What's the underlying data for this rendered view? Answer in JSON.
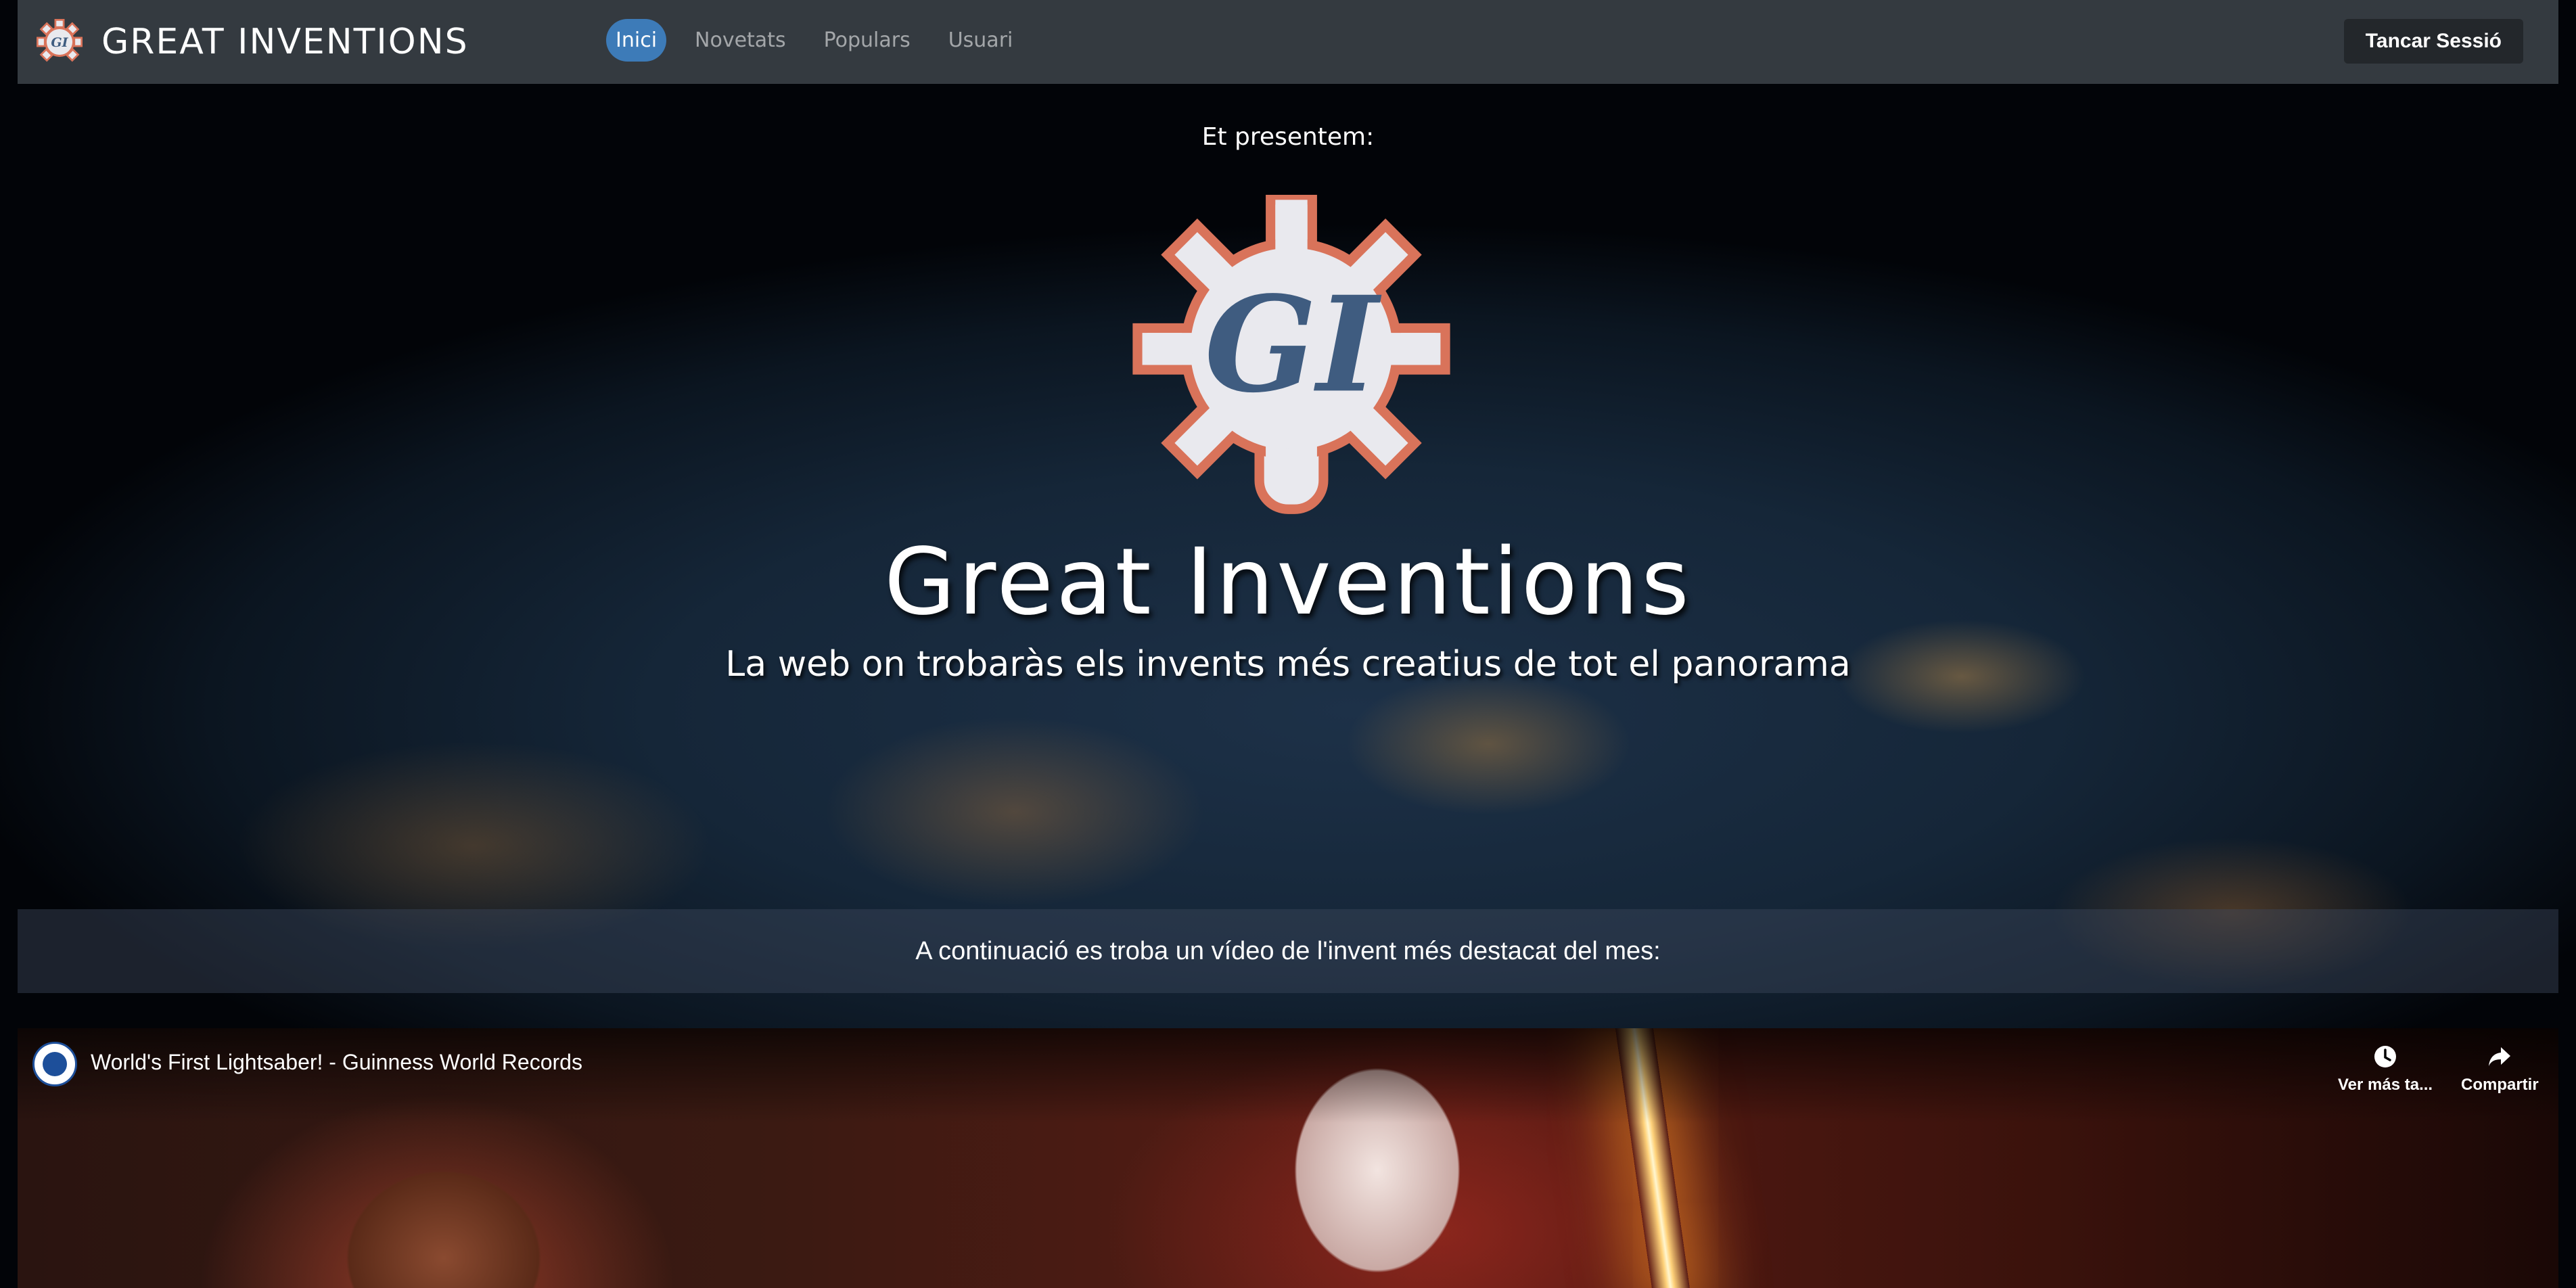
{
  "navbar": {
    "brand": "GREAT INVENTIONS",
    "links": [
      {
        "label": "Inici",
        "active": true
      },
      {
        "label": "Novetats",
        "active": false
      },
      {
        "label": "Populars",
        "active": false
      },
      {
        "label": "Usuari",
        "active": false
      }
    ],
    "logout_label": "Tancar Sessió"
  },
  "hero": {
    "intro": "Et presentem:",
    "logo_letters": "GI",
    "title": "Great Inventions",
    "subtitle": "La web on trobaràs els invents més creatius de tot el panorama"
  },
  "caption": "A continuació es troba un vídeo de l'invent més destacat del mes:",
  "video": {
    "title": "World's First Lightsaber! - Guinness World Records",
    "actions": [
      {
        "label": "Ver más ta...",
        "icon": "clock-icon"
      },
      {
        "label": "Compartir",
        "icon": "share-icon"
      }
    ]
  },
  "colors": {
    "navbar_bg": "#343a40",
    "active_pill": "#3d7bb8",
    "logo_orange": "#d9735a",
    "logo_blue": "#3f5c80"
  }
}
